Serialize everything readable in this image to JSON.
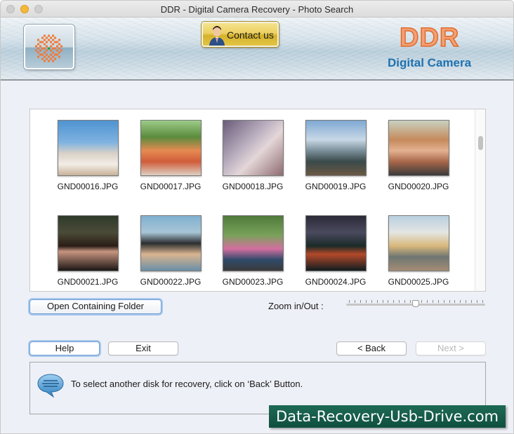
{
  "window": {
    "title": "DDR - Digital Camera Recovery - Photo Search"
  },
  "banner": {
    "logo_icon": "ddr-checker-logo-icon",
    "contact_label": "Contact us",
    "contact_icon": "support-person-icon",
    "brand_title": "DDR",
    "brand_subtitle": "Digital Camera",
    "brand_color": "#e06a2a",
    "subtitle_color": "#1f72b0"
  },
  "gallery": {
    "items": [
      {
        "name": "GND00016.JPG"
      },
      {
        "name": "GND00017.JPG"
      },
      {
        "name": "GND00018.JPG"
      },
      {
        "name": "GND00019.JPG"
      },
      {
        "name": "GND00020.JPG"
      },
      {
        "name": "GND00021.JPG"
      },
      {
        "name": "GND00022.JPG"
      },
      {
        "name": "GND00023.JPG"
      },
      {
        "name": "GND00024.JPG"
      },
      {
        "name": "GND00025.JPG"
      }
    ]
  },
  "controls": {
    "open_folder_label": "Open Containing Folder",
    "zoom_label": "Zoom in/Out :",
    "zoom_value_percent": 50,
    "zoom_tick_count": 25
  },
  "footer": {
    "help_label": "Help",
    "exit_label": "Exit",
    "back_label": "< Back",
    "next_label": "Next >",
    "next_disabled": true
  },
  "status": {
    "icon": "speech-bubble-icon",
    "message": "To select another disk for recovery, click on ‘Back’ Button."
  },
  "watermark": {
    "text": "Data-Recovery-Usb-Drive.com"
  }
}
